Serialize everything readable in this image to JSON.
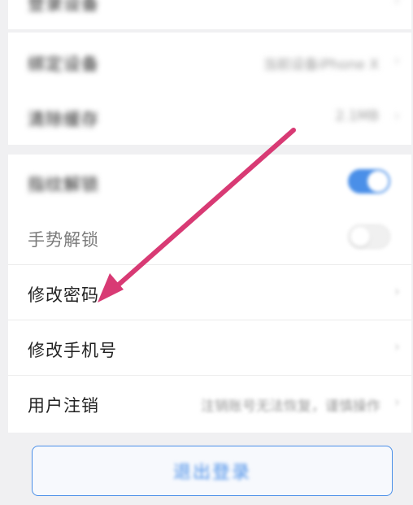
{
  "top_group": {
    "item_label": "登录设备",
    "item_value": ""
  },
  "account_group": {
    "items": [
      {
        "label": "绑定设备",
        "value": "当前设备iPhone X"
      },
      {
        "label": "清除缓存",
        "value": "2.1MB"
      }
    ]
  },
  "security_group": {
    "items": [
      {
        "label": "指纹解锁",
        "toggle": true
      },
      {
        "label": "手势解锁",
        "toggle": false
      },
      {
        "label": "修改密码"
      },
      {
        "label": "修改手机号"
      },
      {
        "label": "用户注销",
        "value": "注销账号无法恢复，谨慎操作"
      }
    ]
  },
  "logout_button": {
    "label": "退出登录"
  },
  "colors": {
    "accent": "#4a8fe8",
    "arrow": "#d83a74",
    "background": "#f0f0f2"
  },
  "icons": {
    "chevron": "chevron-right-icon",
    "arrow": "annotation-arrow"
  }
}
